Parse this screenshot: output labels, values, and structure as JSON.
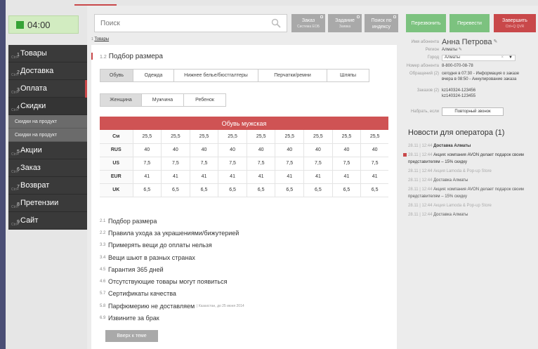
{
  "timer": "04:00",
  "nav": [
    {
      "num": "1",
      "label": "Товары"
    },
    {
      "num": "2",
      "label": "Доставка"
    },
    {
      "num": "3",
      "label": "Оплата"
    },
    {
      "num": "4",
      "label": "Скидки"
    },
    {
      "num": "5",
      "label": "Акции"
    },
    {
      "num": "6",
      "label": "Заказ"
    },
    {
      "num": "7",
      "label": "Возврат"
    },
    {
      "num": "8",
      "label": "Претензии"
    },
    {
      "num": "9",
      "label": "Сайт"
    }
  ],
  "nav_ctrl": "Ctrl+",
  "nav_sub": [
    "Скидки на продукт",
    "Скидки на продукт"
  ],
  "search": {
    "placeholder": "Поиск"
  },
  "header_buttons": [
    {
      "label": "Заказ",
      "sub": "Система ЕОБ"
    },
    {
      "label": "Задание",
      "sub": "Заявка"
    },
    {
      "label": "Поиск по",
      "label2": "индексу"
    }
  ],
  "green_buttons": [
    "Перезвонить",
    "Перевести"
  ],
  "finish": {
    "label": "Завершить",
    "sub": "Ctrl+Q    QVR"
  },
  "breadcrumb": {
    "num": "1",
    "label": "Товары"
  },
  "section": {
    "num": "1.2",
    "title": "Подбор размера"
  },
  "tabs": [
    "Обувь",
    "Одежда",
    "Нижнее белье/бюстгалтеры",
    "Перчатки/ремни",
    "Шляпы"
  ],
  "gender_tabs": [
    "Женщина",
    "Мужчина",
    "Ребенок"
  ],
  "table": {
    "title": "Обувь мужская",
    "rows": [
      {
        "label": "См",
        "values": [
          "25,5",
          "25,5",
          "25,5",
          "25,5",
          "25,5",
          "25,5",
          "25,5",
          "25,5",
          "25,5"
        ]
      },
      {
        "label": "RUS",
        "values": [
          "40",
          "40",
          "40",
          "40",
          "40",
          "40",
          "40",
          "40",
          "40"
        ]
      },
      {
        "label": "US",
        "values": [
          "7,5",
          "7,5",
          "7,5",
          "7,5",
          "7,5",
          "7,5",
          "7,5",
          "7,5",
          "7,5"
        ]
      },
      {
        "label": "EUR",
        "values": [
          "41",
          "41",
          "41",
          "41",
          "41",
          "41",
          "41",
          "41",
          "41"
        ]
      },
      {
        "label": "UK",
        "values": [
          "6,5",
          "6,5",
          "6,5",
          "6,5",
          "6,5",
          "6,5",
          "6,5",
          "6,5",
          "6,5"
        ]
      }
    ]
  },
  "links": [
    {
      "num": "2.1",
      "label": "Подбор размера",
      "note": ""
    },
    {
      "num": "2.2",
      "label": "Правила ухода за украшениями/бижутерией",
      "note": ""
    },
    {
      "num": "3.3",
      "label": "Примерять вещи до оплаты нельзя",
      "note": ""
    },
    {
      "num": "3.4",
      "label": "Вещи шьют в разных странах",
      "note": ""
    },
    {
      "num": "4.5",
      "label": "Гарантия 365 дней",
      "note": ""
    },
    {
      "num": "4.6",
      "label": "Отсутствующие товары могут появиться",
      "note": ""
    },
    {
      "num": "5.7",
      "label": "Сертификаты качества",
      "note": ""
    },
    {
      "num": "5.8",
      "label": "Парфюмерию не доставляем",
      "note": "| Казахстан, до 25 июня 2014"
    },
    {
      "num": "6.9",
      "label": "Извините за брак",
      "note": ""
    }
  ],
  "up_button": "Вверх к теме",
  "subscriber": {
    "name_label": "Имя абонента",
    "name": "Анна Петрова",
    "region_label": "Регион",
    "region": "Алматы",
    "city_label": "Город",
    "city": "Алматы",
    "number_label": "Номер абонента",
    "number": "8-800-070-08-78",
    "requests_label": "Обращений (2)",
    "requests": "сегодня в 07:30 - Информация о заказе",
    "requests2": "вчера в 08:50 - Аннулирование заказа",
    "orders_label": "Заказов (2)",
    "orders": "kz140324-123456",
    "orders2": "kz140324-123455",
    "callback_label": "Набрать, если",
    "callback_button": "Повторный звонок"
  },
  "news": {
    "title": "Новости для оператора (1)",
    "items": [
      {
        "date": "28.11 | 12:44",
        "text": "Доставка Алматы",
        "style": "bold"
      },
      {
        "date": "28.11 | 12:44",
        "text": "Акция: компания AVON делает подарок своим представителям – 15% скидку",
        "style": "first"
      },
      {
        "date": "28.11 | 12:44",
        "text": "Акция Lamoda & Pop-up Store",
        "style": "light"
      },
      {
        "date": "28.11 | 12:44",
        "text": "Доставка Алматы",
        "style": "normal"
      },
      {
        "date": "28.11 | 12:44",
        "text": "Акция: компания AVON делает подарок своим представителям – 15% скидку",
        "style": "normal"
      },
      {
        "date": "28.11 | 12:44",
        "text": "Акция Lamoda & Pop-up Store",
        "style": "light"
      },
      {
        "date": "28.11 | 12:44",
        "text": "Доставка Алматы",
        "style": "normal"
      }
    ]
  },
  "colors": {
    "accent_red": "#c9484a",
    "green": "#7cc27f",
    "sidebar": "#3a3a3a",
    "frame": "#4a4e75"
  }
}
